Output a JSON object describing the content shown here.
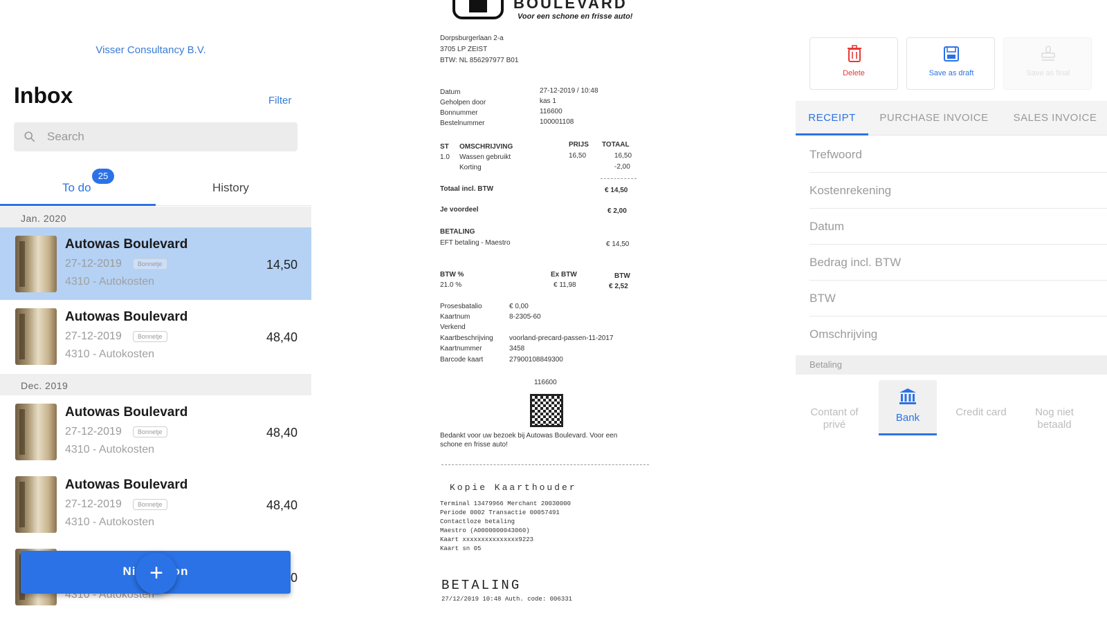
{
  "left": {
    "company": "Visser Consultancy B.V.",
    "title": "Inbox",
    "filter": "Filter",
    "search_placeholder": "Search",
    "tabs": {
      "todo": "To do",
      "todo_badge": "25",
      "history": "History"
    },
    "sections": [
      {
        "header": "Jan. 2020"
      },
      {
        "header": "Dec. 2019"
      }
    ],
    "items": [
      {
        "name": "Autowas Boulevard",
        "date": "27-12-2019",
        "tag": "Bonnetje",
        "account": "4310 - Autokosten",
        "amount": "14,50",
        "selected": true
      },
      {
        "name": "Autowas Boulevard",
        "date": "27-12-2019",
        "tag": "Bonnetje",
        "account": "4310 - Autokosten",
        "amount": "48,40",
        "selected": false
      },
      {
        "name": "Autowas Boulevard",
        "date": "27-12-2019",
        "tag": "Bonnetje",
        "account": "4310 - Autokosten",
        "amount": "48,40",
        "selected": false
      },
      {
        "name": "Autowas Boulevard",
        "date": "27-12-2019",
        "tag": "Bonnetje",
        "account": "4310 - Autokosten",
        "amount": "48,40",
        "selected": false
      },
      {
        "name": "",
        "date": "",
        "tag": "",
        "account": "4310 - Autokosten",
        "amount": "0",
        "selected": false
      }
    ],
    "new_button": "Nieuw bon",
    "fab": "+"
  },
  "receipt": {
    "brand": "BOULEVARD",
    "slogan": "Voor een schone en frisse auto!",
    "address1": "Dorpsburgerlaan 2-a",
    "address2": "3705 LP ZEIST",
    "vat_no": "BTW: NL 856297977 B01",
    "meta_labels": [
      "Datum",
      "Geholpen door",
      "Bonnummer",
      "Bestelnummer"
    ],
    "meta_values": [
      "27-12-2019 / 10:48",
      "kas 1",
      "116600",
      "100001108"
    ],
    "col_qty": "ST",
    "col_desc": "OMSCHRIJVING",
    "col_price": "PRIJS",
    "col_total": "TOTAAL",
    "line_qty": "1.0",
    "line_desc": "Wassen gebruikt",
    "line_price": "16,50",
    "line_total": "16,50",
    "discount_desc": "Korting",
    "discount_total": "-2,00",
    "total_label": "Totaal incl. BTW",
    "total_value": "€ 14,50",
    "advantage_label": "Je voordeel",
    "advantage_value": "€ 2,00",
    "payment_label": "BETALING",
    "payment_method": "EFT betaling - Maestro",
    "payment_value": "€ 14,50",
    "vat_pct_label": "BTW %",
    "vat_pct": "21.0 %",
    "ex_vat_label": "Ex BTW",
    "ex_vat": "€ 11,98",
    "vat_label": "BTW",
    "vat_value": "€ 2,52",
    "card_labels": [
      "Prosesbatalio",
      "Kaartnum",
      "Verkend",
      "Kaartbeschrijving",
      "Kaartnummer",
      "Barcode kaart"
    ],
    "card_values": [
      "€ 0,00",
      "8-2305-60",
      "",
      "voorland-precard-passen-11-2017",
      "3458",
      "27900108849300"
    ],
    "qr_number": "116600",
    "thanks": "Bedankt voor uw bezoek bij Autowas Boulevard. Voor een schone en frisse auto!",
    "copy_title": "Kopie Kaarthouder",
    "terminal_lines": [
      "Terminal  13479966  Merchant  20030000",
      "Periode  0002     Transactie  00057491",
      "Contactloze betaling",
      "Maestro (A0000000043060)",
      "Kaart  xxxxxxxxxxxxxxx9223",
      "Kaart sn  05"
    ],
    "betaling_big": "BETALING",
    "bottom_line": "27/12/2019 10:48     Auth. code:     006331"
  },
  "right": {
    "actions": {
      "delete": "Delete",
      "draft": "Save as draft",
      "final": "Save as final"
    },
    "tabs": [
      "RECEIPT",
      "PURCHASE INVOICE",
      "SALES INVOICE"
    ],
    "fields": [
      "Trefwoord",
      "Kostenrekening",
      "Datum",
      "Bedrag incl. BTW",
      "BTW",
      "Omschrijving"
    ],
    "section": "Betaling",
    "payment_options": [
      "Contant of privé",
      "Bank",
      "Credit card",
      "Nog niet betaald"
    ],
    "colors": {
      "accent": "#2b72e6",
      "danger": "#e53935",
      "selected_row": "#b5d2f5"
    }
  }
}
